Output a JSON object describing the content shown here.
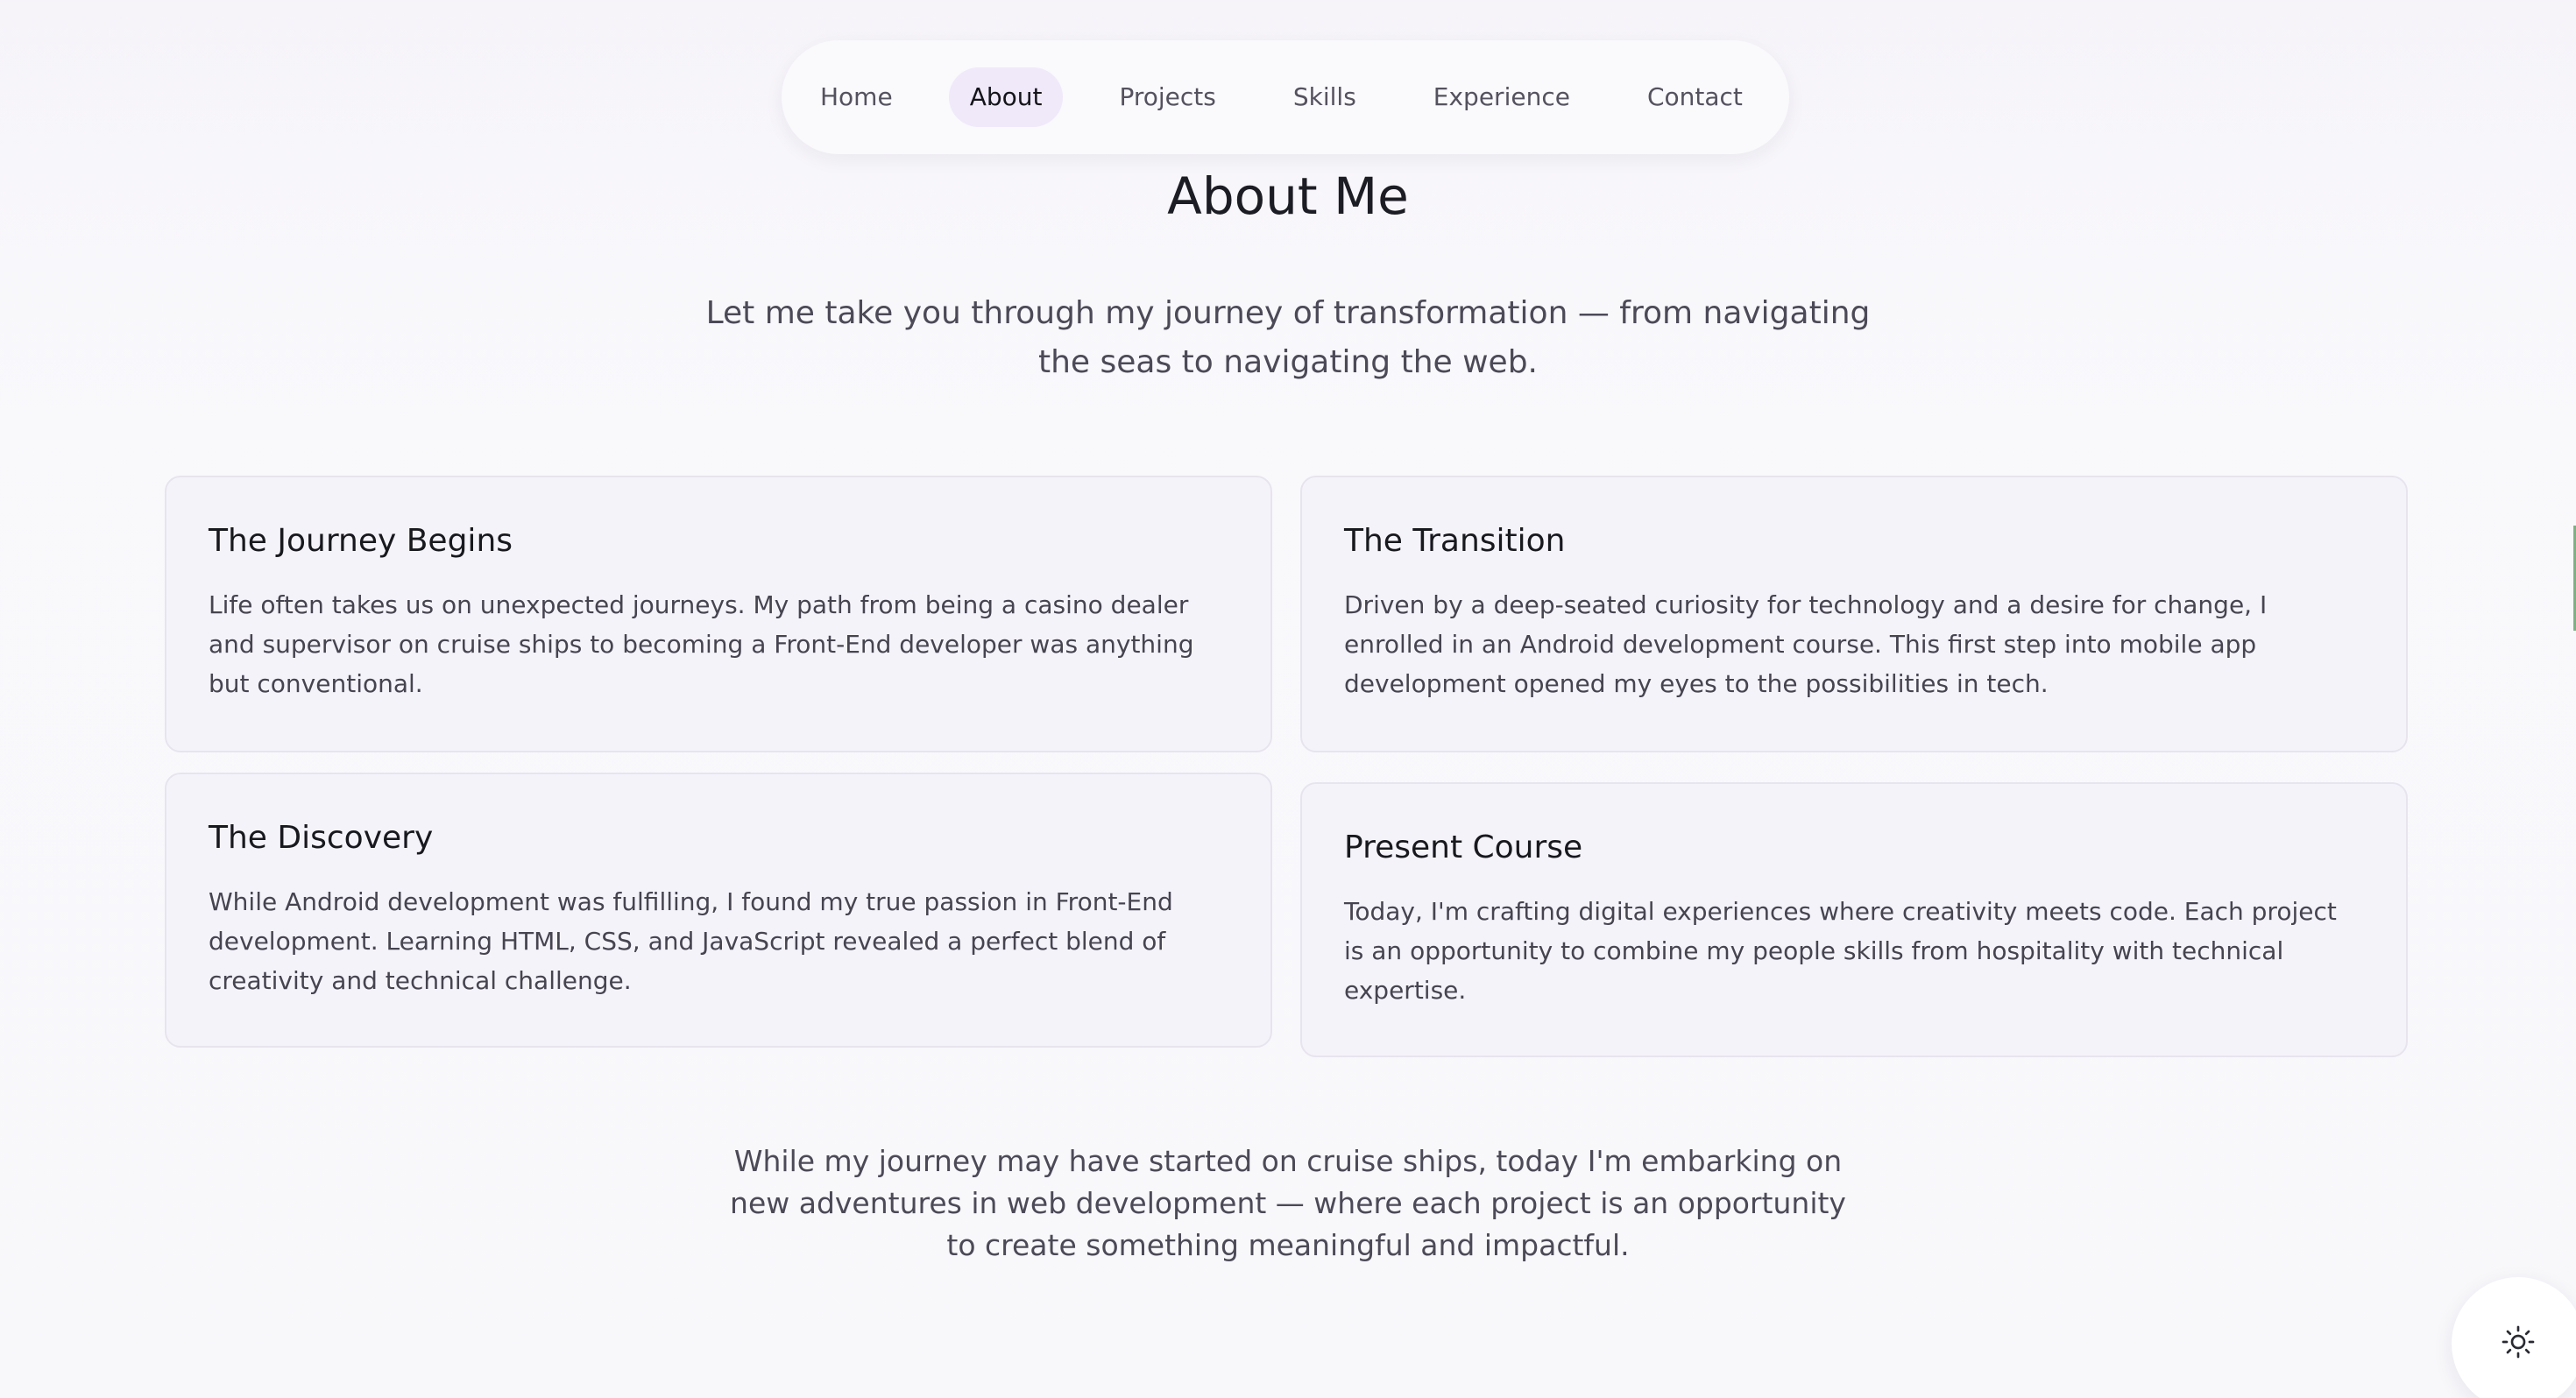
{
  "nav": {
    "items": [
      {
        "label": "Home",
        "active": false
      },
      {
        "label": "About",
        "active": true
      },
      {
        "label": "Projects",
        "active": false
      },
      {
        "label": "Skills",
        "active": false
      },
      {
        "label": "Experience",
        "active": false
      },
      {
        "label": "Contact",
        "active": false
      }
    ]
  },
  "about": {
    "title": "About Me",
    "intro": "Let me take you through my journey of transformation — from navigating the seas to navigating the web.",
    "cards": [
      {
        "heading": "The Journey Begins",
        "text": "Life often takes us on unexpected journeys. My path from being a casino dealer and supervisor on cruise ships to becoming a Front-End developer was anything but conventional."
      },
      {
        "heading": "The Transition",
        "text": "Driven by a deep-seated curiosity for technology and a desire for change, I enrolled in an Android development course. This first step into mobile app development opened my eyes to the possibilities in tech."
      },
      {
        "heading": "The Discovery",
        "text": "While Android development was fulfilling, I found my true passion in Front-End development. Learning HTML, CSS, and JavaScript revealed a perfect blend of creativity and technical challenge."
      },
      {
        "heading": "Present Course",
        "text": "Today, I'm crafting digital experiences where creativity meets code. Each project is an opportunity to combine my people skills from hospitality with technical expertise."
      }
    ],
    "closing": "While my journey may have started on cruise ships, today I'm embarking on new adventures in web development — where each project is an opportunity to create something meaningful and impactful."
  },
  "theme_toggle": {
    "icon": "sun-icon"
  },
  "colors": {
    "accent_active_bg": "#efe9fa",
    "card_bg": "#f5f3fa",
    "text_dark": "#1c1c24",
    "text_muted": "#4c4a57"
  }
}
